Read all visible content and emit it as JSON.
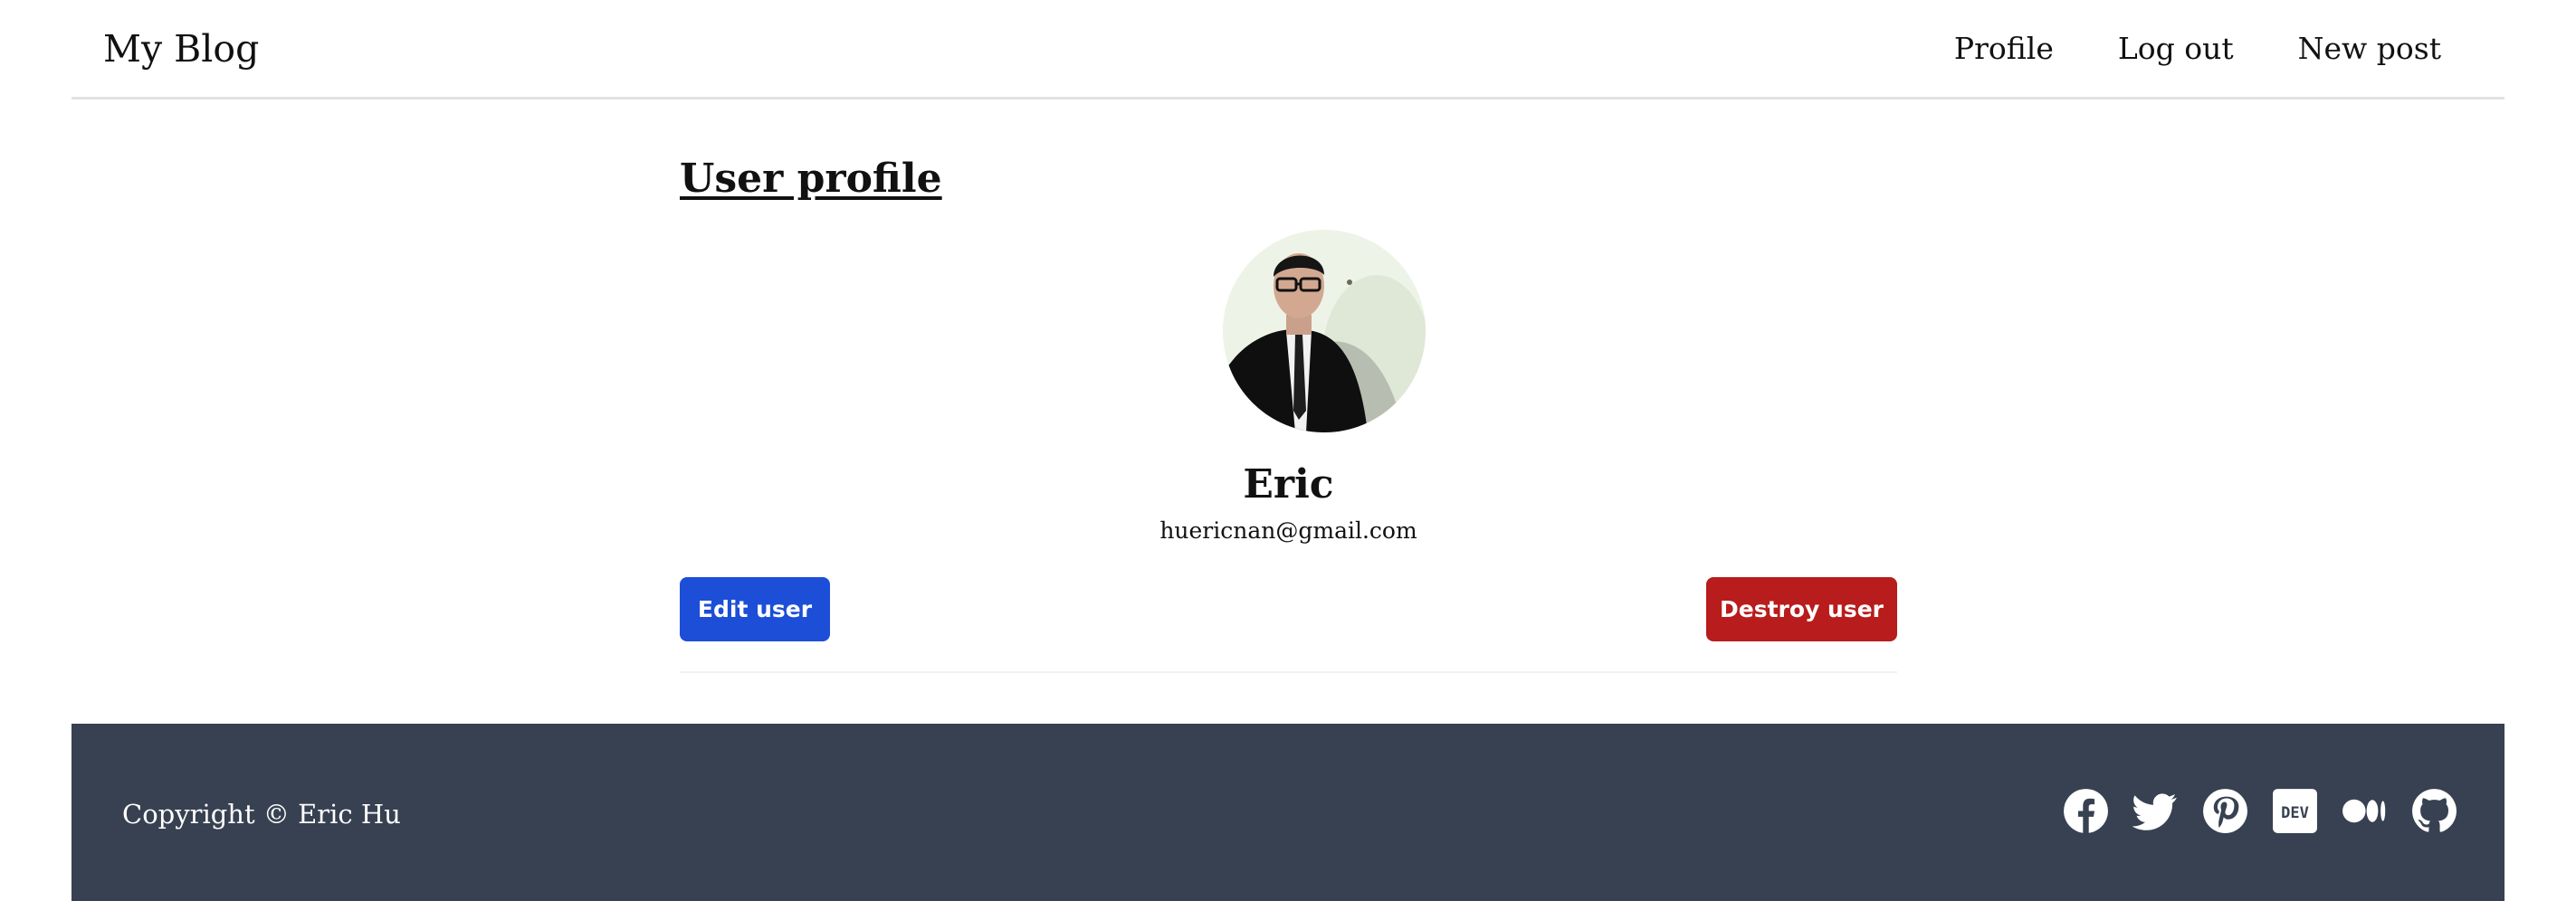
{
  "navbar": {
    "brand": "My Blog",
    "links": [
      {
        "label": "Profile"
      },
      {
        "label": "Log out"
      },
      {
        "label": "New post"
      }
    ]
  },
  "main": {
    "title": "User profile",
    "user": {
      "name": "Eric",
      "email": "huericnan@gmail.com",
      "avatar_alt": "Eric's profile photo"
    },
    "actions": {
      "edit_label": "Edit user",
      "destroy_label": "Destroy user"
    }
  },
  "footer": {
    "copyright": "Copyright © Eric Hu",
    "social_icons": [
      "facebook-icon",
      "twitter-icon",
      "pinterest-icon",
      "dev-icon",
      "medium-icon",
      "github-icon"
    ]
  },
  "colors": {
    "edit_button": "#1d4ed8",
    "destroy_button": "#b91c1c",
    "footer_background": "#374151",
    "divider": "#e2e2e2"
  }
}
